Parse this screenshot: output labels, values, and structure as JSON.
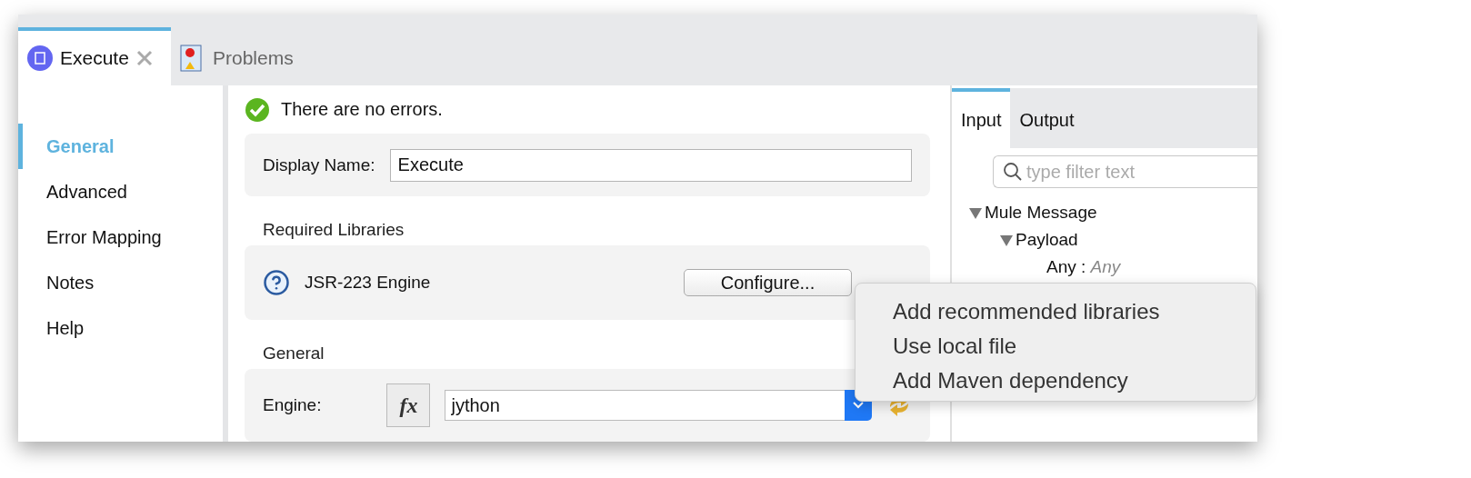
{
  "editor_tabs": [
    {
      "label": "Execute",
      "selected": true,
      "closable": true,
      "kind": "script"
    },
    {
      "label": "Problems",
      "selected": false,
      "closable": false,
      "kind": "problems"
    }
  ],
  "sidebar": {
    "items": [
      {
        "label": "General",
        "selected": true
      },
      {
        "label": "Advanced",
        "selected": false
      },
      {
        "label": "Error Mapping",
        "selected": false
      },
      {
        "label": "Notes",
        "selected": false
      },
      {
        "label": "Help",
        "selected": false
      }
    ]
  },
  "status": {
    "text": "There are no errors."
  },
  "display_name": {
    "label": "Display Name:",
    "value": "Execute"
  },
  "required_libraries": {
    "title": "Required Libraries",
    "library": "JSR-223 Engine",
    "button": "Configure..."
  },
  "general": {
    "title": "General",
    "engine_label": "Engine:",
    "expression_button": "fx",
    "engine_value": "jython"
  },
  "right_panel": {
    "tabs": [
      {
        "label": "Input",
        "selected": true
      },
      {
        "label": "Output",
        "selected": false
      }
    ],
    "filter": {
      "placeholder": "type filter text"
    },
    "tree": [
      {
        "label": "Mule Message",
        "expanded": true,
        "children": [
          {
            "label": "Payload",
            "expanded": true,
            "children": [
              {
                "label": "Any : ",
                "type": "Any"
              }
            ]
          }
        ]
      }
    ]
  },
  "popup_menu": {
    "items": [
      "Add recommended libraries",
      "Use local file",
      "Add Maven dependency"
    ]
  }
}
